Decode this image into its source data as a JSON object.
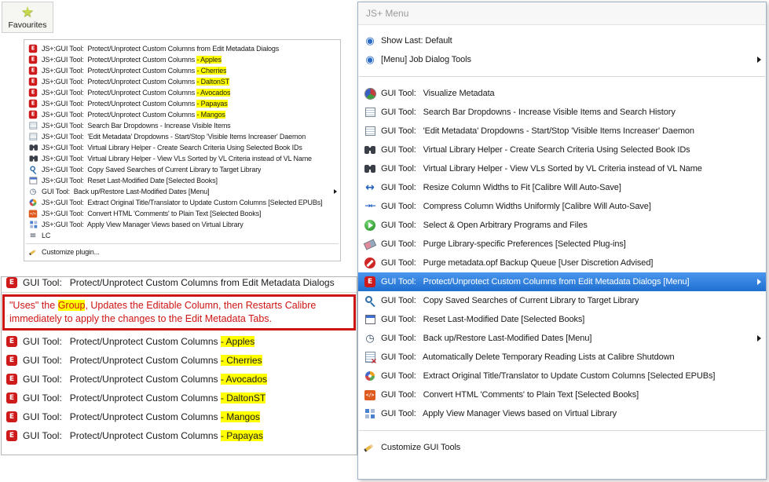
{
  "colors": {
    "selection_blue": "#4b97ee",
    "highlight_yellow": "#ffff00",
    "annotation_red": "#cf1414"
  },
  "favourites_button": {
    "label": "Favourites",
    "icon": "star-icon"
  },
  "top_menu": {
    "items": [
      {
        "icon": "protect-columns-icon",
        "pre": "JS+:GUI Tool:  Protect/Unprotect Custom Columns from Edit Metadata Dialogs"
      },
      {
        "icon": "protect-columns-icon",
        "pre": "JS+:GUI Tool:  Protect/Unprotect Custom Columns ",
        "hl": "- Apples"
      },
      {
        "icon": "protect-columns-icon",
        "pre": "JS+:GUI Tool:  Protect/Unprotect Custom Columns ",
        "hl": "- Cherries"
      },
      {
        "icon": "protect-columns-icon",
        "pre": "JS+:GUI Tool:  Protect/Unprotect Custom Columns ",
        "hl": "- DaltonST"
      },
      {
        "icon": "protect-columns-icon",
        "pre": "JS+:GUI Tool:  Protect/Unprotect Custom Columns ",
        "hl": "- Avocados"
      },
      {
        "icon": "protect-columns-icon",
        "pre": "JS+:GUI Tool:  Protect/Unprotect Custom Columns ",
        "hl": "- Papayas"
      },
      {
        "icon": "protect-columns-icon",
        "pre": "JS+:GUI Tool:  Protect/Unprotect Custom Columns ",
        "hl": "- Mangos"
      },
      {
        "icon": "combobox-icon",
        "pre": "JS+:GUI Tool:  Search Bar Dropdowns - Increase Visible Items"
      },
      {
        "icon": "combobox-icon",
        "pre": "JS+:GUI Tool:  'Edit Metadata' Dropdowns - Start/Stop 'Visible Items Increaser' Daemon"
      },
      {
        "icon": "binoculars-icon",
        "pre": "JS+:GUI Tool:  Virtual Library Helper - Create Search Criteria Using Selected Book IDs"
      },
      {
        "icon": "binoculars-icon",
        "pre": "JS+:GUI Tool:  Virtual Library Helper - View VLs Sorted by VL Criteria instead of VL Name"
      },
      {
        "icon": "copy-searches-icon",
        "pre": "JS+:GUI Tool:  Copy Saved Searches of Current Library to Target Library"
      },
      {
        "icon": "reset-date-icon",
        "pre": "JS+:GUI Tool:  Reset Last-Modified Date [Selected Books]"
      },
      {
        "icon": "backup-dates-icon",
        "pre": "GUI Tool:  Back up/Restore Last-Modified Dates [Menu]",
        "arrow": true
      },
      {
        "icon": "extract-icon",
        "pre": "JS+:GUI Tool:  Extract Original Title/Translator to Update Custom Columns [Selected EPUBs]"
      },
      {
        "icon": "convert-html-icon",
        "pre": "JS+:GUI Tool:  Convert HTML 'Comments' to Plain Text [Selected Books]"
      },
      {
        "icon": "view-manager-icon",
        "pre": "JS+:GUI Tool:  Apply View Manager Views based on Virtual Library"
      },
      {
        "icon": "lc-icon",
        "pre": "LC"
      },
      {
        "type": "separator"
      },
      {
        "icon": "customize-icon",
        "pre": "Customize plugin..."
      }
    ]
  },
  "bottom_panel": {
    "clipped_item": {
      "icon": "protect-columns-icon",
      "pre": "GUI Tool:   Protect/Unprotect Custom Columns from Edit Metadata Dialogs"
    },
    "annotation": {
      "pre": "\"Uses\" the ",
      "hl": "Group",
      "post": ", Updates the Editable Column, then Restarts Calibre immediately to apply the changes to the Edit Metadata Tabs."
    },
    "items": [
      {
        "icon": "protect-columns-icon",
        "pre": "GUI Tool:   Protect/Unprotect Custom Columns ",
        "hl": "- Apples"
      },
      {
        "icon": "protect-columns-icon",
        "pre": "GUI Tool:   Protect/Unprotect Custom Columns ",
        "hl": "- Cherries"
      },
      {
        "icon": "protect-columns-icon",
        "pre": "GUI Tool:   Protect/Unprotect Custom Columns ",
        "hl": "- Avocados"
      },
      {
        "icon": "protect-columns-icon",
        "pre": "GUI Tool:   Protect/Unprotect Custom Columns ",
        "hl": "- DaltonST"
      },
      {
        "icon": "protect-columns-icon",
        "pre": "GUI Tool:   Protect/Unprotect Custom Columns ",
        "hl": "- Mangos"
      },
      {
        "icon": "protect-columns-icon",
        "pre": "GUI Tool:   Protect/Unprotect Custom Columns ",
        "hl": "- Papayas"
      }
    ]
  },
  "right_menu": {
    "title": "JS+ Menu",
    "items": [
      {
        "icon": "eye-icon",
        "pre": "Show Last: Default"
      },
      {
        "icon": "eye-icon",
        "pre": "[Menu] Job Dialog Tools",
        "arrow": true
      },
      {
        "type": "separator"
      },
      {
        "icon": "pie-chart-icon",
        "pre": "GUI Tool:   Visualize Metadata"
      },
      {
        "icon": "combobox-icon",
        "pre": "GUI Tool:   Search Bar Dropdowns - Increase Visible Items and Search History"
      },
      {
        "icon": "combobox-icon",
        "pre": "GUI Tool:   'Edit Metadata' Dropdowns - Start/Stop 'Visible Items Increaser' Daemon"
      },
      {
        "icon": "binoculars-icon",
        "pre": "GUI Tool:   Virtual Library Helper - Create Search Criteria Using Selected Book IDs"
      },
      {
        "icon": "binoculars-icon",
        "pre": "GUI Tool:   Virtual Library Helper - View VLs Sorted by VL Criteria instead of VL Name"
      },
      {
        "icon": "resize-icon",
        "pre": "GUI Tool:   Resize Column Widths to Fit [Calibre Will Auto-Save]"
      },
      {
        "icon": "compress-icon",
        "pre": "GUI Tool:   Compress Column Widths Uniformly [Calibre Will Auto-Save]"
      },
      {
        "icon": "play-icon",
        "pre": "GUI Tool:   Select & Open Arbitrary Programs and Files"
      },
      {
        "icon": "eraser-icon",
        "pre": "GUI Tool:   Purge Library-specific Preferences [Selected Plug-ins]"
      },
      {
        "icon": "no-entry-icon",
        "pre": "GUI Tool:   Purge metadata.opf Backup Queue [User Discretion Advised]"
      },
      {
        "icon": "protect-columns-icon",
        "pre": "GUI Tool:   Protect/Unprotect Custom Columns from Edit Metadata Dialogs [Menu]",
        "selected": true,
        "arrow": true
      },
      {
        "icon": "copy-searches-icon",
        "pre": "GUI Tool:   Copy Saved Searches of Current Library to Target Library"
      },
      {
        "icon": "reset-date-icon",
        "pre": "GUI Tool:   Reset Last-Modified Date [Selected Books]"
      },
      {
        "icon": "backup-dates-icon",
        "pre": "GUI Tool:   Back up/Restore Last-Modified Dates [Menu]",
        "arrow": true
      },
      {
        "icon": "auto-delete-icon",
        "pre": "GUI Tool:   Automatically Delete Temporary Reading Lists at Calibre Shutdown"
      },
      {
        "icon": "extract-icon",
        "pre": "GUI Tool:   Extract Original Title/Translator to Update Custom Columns [Selected EPUBs]"
      },
      {
        "icon": "convert-html-icon",
        "pre": "GUI Tool:   Convert HTML 'Comments' to Plain Text [Selected Books]"
      },
      {
        "icon": "view-manager-icon",
        "pre": "GUI Tool:   Apply View Manager Views based on Virtual Library"
      },
      {
        "type": "separator"
      },
      {
        "icon": "customize-icon",
        "pre": "Customize GUI Tools"
      }
    ]
  }
}
